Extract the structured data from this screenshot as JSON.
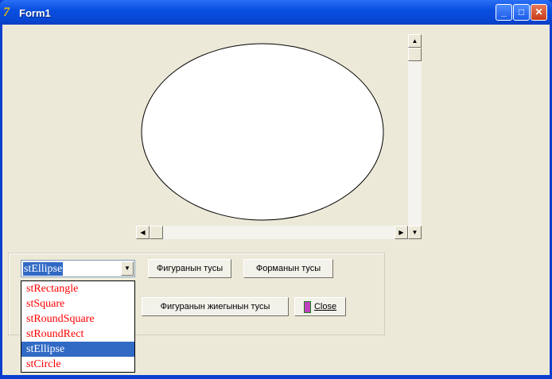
{
  "window": {
    "title": "Form1"
  },
  "combo": {
    "value": "stEllipse",
    "options": [
      "stRectangle",
      "stSquare",
      "stRoundSquare",
      "stRoundRect",
      "stEllipse",
      "stCircle"
    ],
    "selected_index": 4
  },
  "buttons": {
    "shape_color": "Фигуранын тусы",
    "form_color": "Форманын тусы",
    "pen_color": "Фигуранын жиегынын тусы",
    "close": "Close"
  },
  "colors": {
    "item_text": "#ff0000",
    "selection": "#316ac5"
  }
}
